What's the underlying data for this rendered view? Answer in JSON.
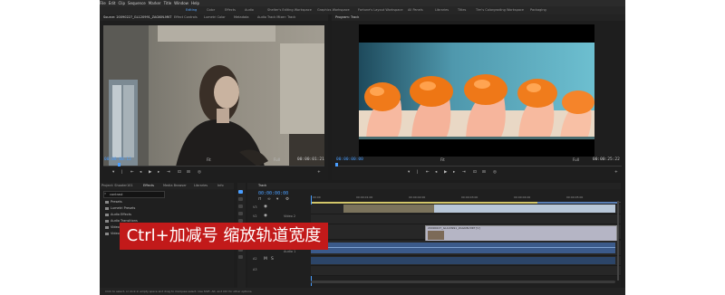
{
  "menu": [
    "File",
    "Edit",
    "Clip",
    "Sequence",
    "Marker",
    "Title",
    "Window",
    "Help"
  ],
  "workspaces": [
    {
      "label": "Editing",
      "active": true
    },
    {
      "label": "Color",
      "active": false
    },
    {
      "label": "Effects",
      "active": false
    },
    {
      "label": "Audio",
      "active": false
    },
    {
      "label": "Shelter's Editing Workspace",
      "active": false
    },
    {
      "label": "Graphics Workspace",
      "active": false
    },
    {
      "label": "Fortune's Layout Workspace",
      "active": false
    },
    {
      "label": "All Panels",
      "active": false
    },
    {
      "label": "Libraries",
      "active": false
    },
    {
      "label": "Titles",
      "active": false
    },
    {
      "label": "Tim's Colorgrading Workspace",
      "active": false
    },
    {
      "label": "Packaging",
      "active": false
    }
  ],
  "source": {
    "tabs": [
      "Source: 20090227_GL120991_ZAGKIN.MKT",
      "Effect Controls",
      "Lumetri Color",
      "Metadata",
      "Audio Track Mixer: Track"
    ],
    "timecode_in": "00:00:00:12",
    "fit": "Fit",
    "scale": "Full",
    "timecode_out": "00:00:01:21"
  },
  "program": {
    "tab": "Program: Track",
    "timecode_in": "00:00:00:00",
    "fit": "Fit",
    "scale": "Full",
    "timecode_out": "00:00:25:22"
  },
  "project": {
    "tabs": [
      "Project: Shooter101",
      "Effects",
      "Media Browser",
      "Libraries",
      "Info"
    ],
    "search": "contrast",
    "items": [
      "Presets",
      "Lumetri Presets",
      "Audio Effects",
      "Audio Transitions",
      "Video Effects",
      "Video Transitions"
    ]
  },
  "timeline": {
    "tab": "Track",
    "timecode": "00:00:00:00",
    "ruler": [
      "00:00",
      "00:00:01:00",
      "00:00:02:00",
      "00:00:03:00",
      "00:00:04:00",
      "00:00:05:00"
    ],
    "video_tracks": [
      "V3",
      "V2",
      "V1"
    ],
    "audio_tracks": [
      "A1",
      "A2",
      "A3"
    ],
    "video_track_names": [
      "",
      "Video 2",
      ""
    ],
    "audio_track_names": [
      "Audio 1",
      "",
      ""
    ],
    "clip_label": "20090227_GL120991_ZAGKIN.MKT [V]",
    "overlay_text": "Ctrl+加减号 缩放轨道宽度"
  },
  "status": "Click to select, or click in empty space and drag to marquee select. Use Shift, Alt, and Ctrl for other options.",
  "colors": {
    "accent": "#4a9eff",
    "overlay_bg": "#c21a1a",
    "audio_clip": "#3b5a8a",
    "video_clip": "#b5b5c5"
  }
}
